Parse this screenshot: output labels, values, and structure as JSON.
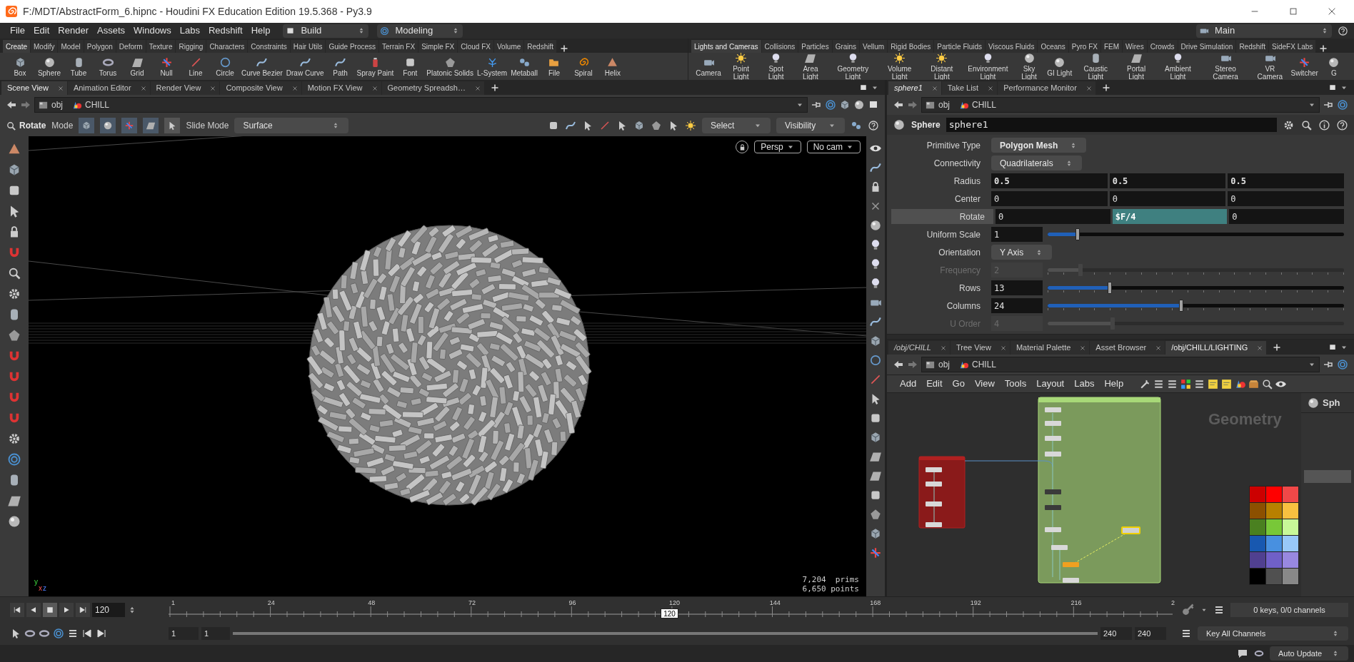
{
  "window": {
    "title": "F:/MDT/AbstractForm_6.hipnc - Houdini FX Education Edition 19.5.368 - Py3.9"
  },
  "menu": [
    "File",
    "Edit",
    "Render",
    "Assets",
    "Windows",
    "Labs",
    "Redshift",
    "Help"
  ],
  "desktops": [
    "Build",
    "Modeling"
  ],
  "main_desktop": "Main",
  "shelf_left": {
    "tabs": [
      {
        "label": "Create",
        "selected": true
      },
      {
        "label": "Modify",
        "selected": false
      },
      {
        "label": "Model",
        "selected": false
      },
      {
        "label": "Polygon",
        "selected": false
      },
      {
        "label": "Deform",
        "selected": false
      },
      {
        "label": "Texture",
        "selected": false
      },
      {
        "label": "Rigging",
        "selected": false
      },
      {
        "label": "Characters",
        "selected": false
      },
      {
        "label": "Constraints",
        "selected": false
      },
      {
        "label": "Hair Utils",
        "selected": false
      },
      {
        "label": "Guide Process",
        "selected": false
      },
      {
        "label": "Terrain FX",
        "selected": false
      },
      {
        "label": "Simple FX",
        "selected": false
      },
      {
        "label": "Cloud FX",
        "selected": false
      },
      {
        "label": "Volume",
        "selected": false
      },
      {
        "label": "Redshift",
        "selected": false
      }
    ],
    "tools": [
      {
        "label": "Box",
        "kind": "cube"
      },
      {
        "label": "Sphere",
        "kind": "sphere"
      },
      {
        "label": "Tube",
        "kind": "cylinder"
      },
      {
        "label": "Torus",
        "kind": "torus"
      },
      {
        "label": "Grid",
        "kind": "plane"
      },
      {
        "label": "Null",
        "kind": "cross"
      },
      {
        "label": "Line",
        "kind": "line"
      },
      {
        "label": "Circle",
        "kind": "circle"
      },
      {
        "label": "Curve Bezier",
        "kind": "curve"
      },
      {
        "label": "Draw Curve",
        "kind": "curve"
      },
      {
        "label": "Path",
        "kind": "curve"
      },
      {
        "label": "Spray Paint",
        "kind": "can"
      },
      {
        "label": "Font",
        "kind": "block"
      },
      {
        "label": "Platonic Solids",
        "kind": "gem"
      },
      {
        "label": "L-System",
        "kind": "tree"
      },
      {
        "label": "Metaball",
        "kind": "balls"
      },
      {
        "label": "File",
        "kind": "folder"
      },
      {
        "label": "Spiral",
        "kind": "spiral"
      },
      {
        "label": "Helix",
        "kind": "cone"
      }
    ]
  },
  "shelf_right": {
    "tabs": [
      {
        "label": "Lights and Cameras",
        "selected": true
      },
      {
        "label": "Collisions",
        "selected": false
      },
      {
        "label": "Particles",
        "selected": false
      },
      {
        "label": "Grains",
        "selected": false
      },
      {
        "label": "Vellum",
        "selected": false
      },
      {
        "label": "Rigid Bodies",
        "selected": false
      },
      {
        "label": "Particle Fluids",
        "selected": false
      },
      {
        "label": "Viscous Fluids",
        "selected": false
      },
      {
        "label": "Oceans",
        "selected": false
      },
      {
        "label": "Pyro FX",
        "selected": false
      },
      {
        "label": "FEM",
        "selected": false
      },
      {
        "label": "Wires",
        "selected": false
      },
      {
        "label": "Crowds",
        "selected": false
      },
      {
        "label": "Drive Simulation",
        "selected": false
      },
      {
        "label": "Redshift",
        "selected": false
      },
      {
        "label": "SideFX Labs",
        "selected": false
      }
    ],
    "tools": [
      {
        "label": "Camera",
        "kind": "camera"
      },
      {
        "label": "Point Light",
        "kind": "sun"
      },
      {
        "label": "Spot Light",
        "kind": "bulb"
      },
      {
        "label": "Area Light",
        "kind": "plane"
      },
      {
        "label": "Geometry Light",
        "kind": "bulb"
      },
      {
        "label": "Volume Light",
        "kind": "sun"
      },
      {
        "label": "Distant Light",
        "kind": "sun"
      },
      {
        "label": "Environment Light",
        "kind": "bulb"
      },
      {
        "label": "Sky Light",
        "kind": "sphere"
      },
      {
        "label": "GI Light",
        "kind": "sphere"
      },
      {
        "label": "Caustic Light",
        "kind": "cylinder"
      },
      {
        "label": "Portal Light",
        "kind": "plane"
      },
      {
        "label": "Ambient Light",
        "kind": "bulb"
      },
      {
        "label": "Stereo Camera",
        "kind": "camera"
      },
      {
        "label": "VR Camera",
        "kind": "camera"
      },
      {
        "label": "Switcher",
        "kind": "cross"
      },
      {
        "label": "G",
        "kind": "sphere"
      }
    ]
  },
  "scene_view": {
    "tabs": [
      {
        "label": "Scene View",
        "selected": true
      },
      {
        "label": "Animation Editor",
        "selected": false
      },
      {
        "label": "Render View",
        "selected": false
      },
      {
        "label": "Composite View",
        "selected": false
      },
      {
        "label": "Motion FX View",
        "selected": false
      },
      {
        "label": "Geometry Spreadsh…",
        "selected": false
      }
    ],
    "path": [
      "obj",
      "CHILL"
    ],
    "toolbar": {
      "tool": "Rotate",
      "mode_label": "Mode",
      "slide_label": "Slide Mode",
      "slide_mode": "Surface",
      "select": "Select",
      "visibility": "Visibility"
    },
    "viewport": {
      "view": "Persp",
      "camera": "No cam",
      "prims": "7,204  prims",
      "points": "6,650 points",
      "axes": [
        "y",
        "x",
        "z"
      ]
    }
  },
  "parameters": {
    "tabs": [
      {
        "label": "sphere1",
        "selected": true
      },
      {
        "label": "Take List",
        "selected": false
      },
      {
        "label": "Performance Monitor",
        "selected": false
      }
    ],
    "path": [
      "obj",
      "CHILL"
    ],
    "node_type": "Sphere",
    "node_name": "sphere1",
    "rows": [
      {
        "kind": "menu",
        "label": "Primitive Type",
        "value": "Polygon Mesh",
        "modified": true
      },
      {
        "kind": "menu",
        "label": "Connectivity",
        "value": "Quadrilaterals",
        "modified": false
      },
      {
        "kind": "vector",
        "label": "Radius",
        "modified": true,
        "highlighted": false,
        "values": [
          {
            "text": "0.5",
            "expression": false
          },
          {
            "text": "0.5",
            "expression": false
          },
          {
            "text": "0.5",
            "expression": false
          }
        ]
      },
      {
        "kind": "vector",
        "label": "Center",
        "modified": false,
        "highlighted": false,
        "values": [
          {
            "text": "0",
            "expression": false
          },
          {
            "text": "0",
            "expression": false
          },
          {
            "text": "0",
            "expression": false
          }
        ]
      },
      {
        "kind": "vector",
        "label": "Rotate",
        "modified": false,
        "highlighted": true,
        "values": [
          {
            "text": "0",
            "expression": false
          },
          {
            "text": "$F/4",
            "expression": true
          },
          {
            "text": "0",
            "expression": false
          }
        ]
      },
      {
        "kind": "slider",
        "label": "Uniform Scale",
        "value": "1",
        "level": 0.1,
        "disabled": false,
        "ticks": false
      },
      {
        "kind": "menu",
        "label": "Orientation",
        "value": "Y Axis",
        "modified": false
      },
      {
        "kind": "slider",
        "label": "Frequency",
        "value": "2",
        "level": 0.11,
        "disabled": true,
        "ticks": true
      },
      {
        "kind": "slider",
        "label": "Rows",
        "value": "13",
        "level": 0.21,
        "disabled": false,
        "ticks": true
      },
      {
        "kind": "slider",
        "label": "Columns",
        "value": "24",
        "level": 0.45,
        "disabled": false,
        "ticks": true
      },
      {
        "kind": "slider",
        "label": "U Order",
        "value": "4",
        "level": 0.22,
        "disabled": true,
        "ticks": false
      }
    ]
  },
  "network": {
    "tabs": [
      {
        "label": "/obj/CHILL",
        "selected": false
      },
      {
        "label": "Tree View",
        "selected": false
      },
      {
        "label": "Material Palette",
        "selected": false
      },
      {
        "label": "Asset Browser",
        "selected": false
      },
      {
        "label": "/obj/CHILL/LIGHTING",
        "selected": true
      }
    ],
    "path": [
      "obj",
      "CHILL"
    ],
    "menu": [
      "Add",
      "Edit",
      "Go",
      "View",
      "Tools",
      "Layout",
      "Labs",
      "Help"
    ],
    "context_label": "Geometry",
    "side_label": "Sph",
    "palette": [
      {
        "color": "#cc0000"
      },
      {
        "color": "#ff0000"
      },
      {
        "color": "#f04848"
      },
      {
        "color": "#8c5000"
      },
      {
        "color": "#b88000"
      },
      {
        "color": "#f8c040"
      },
      {
        "color": "#4a8020"
      },
      {
        "color": "#78c838"
      },
      {
        "color": "#c8f898"
      },
      {
        "color": "#1858b0"
      },
      {
        "color": "#4890e0"
      },
      {
        "color": "#98c8f8"
      },
      {
        "color": "#504090"
      },
      {
        "color": "#7060c8"
      },
      {
        "color": "#9888e0"
      },
      {
        "color": "#000000"
      },
      {
        "color": "#505050"
      },
      {
        "color": "#888888"
      }
    ]
  },
  "timeline": {
    "frame_field": "120",
    "ticks": [
      "1",
      "24",
      "48",
      "72",
      "96",
      "120",
      "144",
      "168",
      "192",
      "216",
      "2"
    ],
    "current_frame": "120",
    "level": 0.498,
    "range_start": "1",
    "range_start_field": "1",
    "range_end": "240",
    "range_end_field": "240",
    "keys_info": "0 keys, 0/0 channels",
    "key_mode": "Key All Channels"
  },
  "status": {
    "update_mode": "Auto Update"
  }
}
